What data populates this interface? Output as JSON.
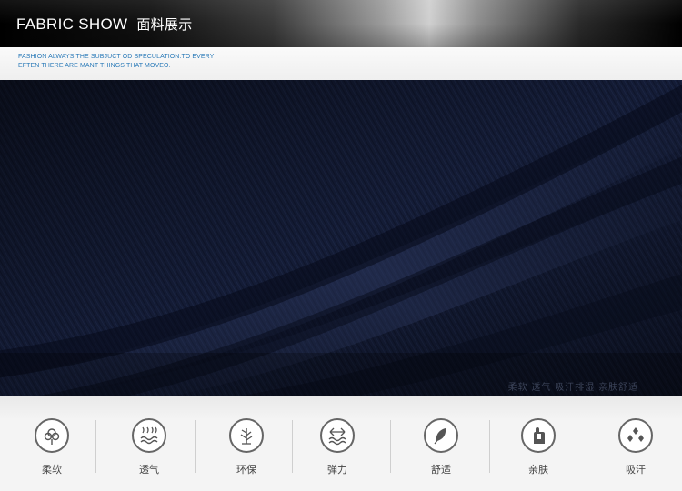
{
  "header": {
    "title_en": "FABRIC SHOW",
    "title_cn": "面料展示"
  },
  "slogan": {
    "line1": "FASHION ALWAYS THE  SUBJUCT OD SPECULATION.TO EVERY",
    "line2": "EFTEN THERE ARE MANT THINGS THAT MOVEO."
  },
  "fabric": {
    "color": "#121a33",
    "caption": "柔软  透气  吸汗排湿  亲肤舒适"
  },
  "features": [
    {
      "icon": "cotton-icon",
      "label": "柔软"
    },
    {
      "icon": "breathable-icon",
      "label": "透气"
    },
    {
      "icon": "eco-tree-icon",
      "label": "环保"
    },
    {
      "icon": "elastic-icon",
      "label": "弹力"
    },
    {
      "icon": "feather-icon",
      "label": "舒适"
    },
    {
      "icon": "skin-friendly-icon",
      "label": "亲肤"
    },
    {
      "icon": "sweat-absorb-icon",
      "label": "吸汗"
    }
  ]
}
